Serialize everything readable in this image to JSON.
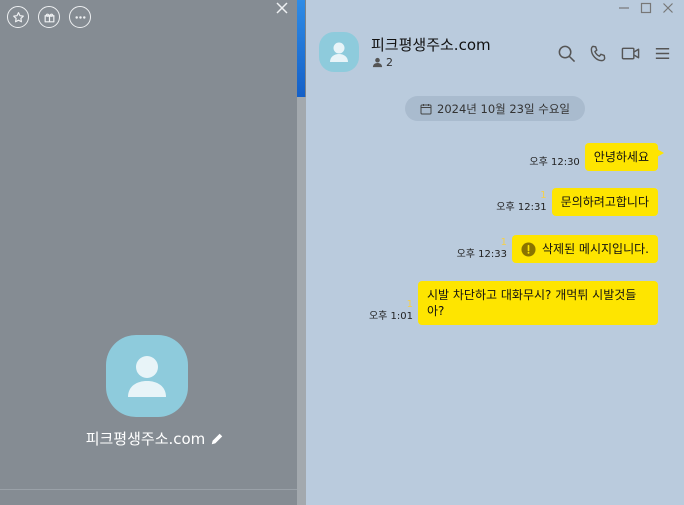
{
  "profile_panel": {
    "name": "피크평생주소.com",
    "icons": [
      "star-icon",
      "gift-icon",
      "more-icon",
      "close-icon",
      "edit-icon"
    ]
  },
  "chat": {
    "title": "피크평생주소.com",
    "member_count": "2",
    "date_divider": "2024년 10월 23일 수요일",
    "header_icons": [
      "search-icon",
      "phone-icon",
      "video-icon",
      "menu-icon"
    ],
    "window_icons": [
      "minimize-icon",
      "maximize-icon",
      "close-icon"
    ],
    "messages": [
      {
        "time": "오후 12:30",
        "unread": "",
        "text": "안녕하세요"
      },
      {
        "time": "오후 12:31",
        "unread": "1",
        "text": "문의하려고합니다"
      },
      {
        "time": "오후 12:33",
        "unread": "1",
        "text": "삭제된 메시지입니다.",
        "deleted": true
      },
      {
        "time": "오후 1:01",
        "unread": "1",
        "text": "시발 차단하고 대화무시? 개먹튀 시발것들아?"
      }
    ]
  },
  "colors": {
    "bubble": "#fee500",
    "chat_bg": "#bacbdd",
    "panel_bg": "#858c93",
    "avatar": "#8ecbdc"
  }
}
